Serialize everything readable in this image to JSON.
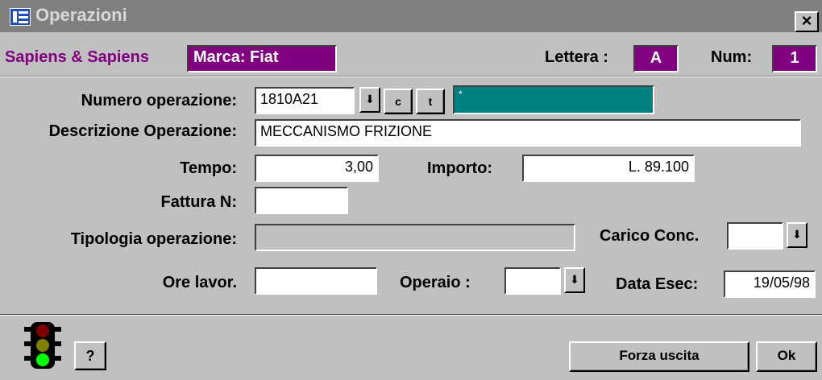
{
  "window": {
    "title": "Operazioni",
    "close_glyph": "×",
    "icon": "form-icon"
  },
  "header": {
    "company": "Sapiens & Sapiens",
    "marca": "Marca: Fiat",
    "lettera_label": "Lettera :",
    "lettera_value": "A",
    "num_label": "Num:",
    "num_value": "1"
  },
  "form": {
    "numero_operazione": {
      "label": "Numero operazione:",
      "value": "1810A21",
      "dropdown_glyph": "⬇",
      "btn_c": "c",
      "btn_t": "t",
      "code_value": "*"
    },
    "descrizione": {
      "label": "Descrizione Operazione:",
      "value": "MECCANISMO FRIZIONE"
    },
    "tempo": {
      "label": "Tempo:",
      "value": "3,00"
    },
    "importo": {
      "label": "Importo:",
      "value": "L. 89.100"
    },
    "fattura": {
      "label": "Fattura N:",
      "value": ""
    },
    "tipologia": {
      "label": "Tipologia operazione:",
      "value": ""
    },
    "carico_conc": {
      "label": "Carico Conc.",
      "value": ""
    },
    "ore_lavor": {
      "label": "Ore lavor.",
      "value": ""
    },
    "operaio": {
      "label": "Operaio :",
      "value": ""
    },
    "data_esec": {
      "label": "Data Esec:",
      "value": "19/05/98"
    }
  },
  "footer": {
    "help_label": "?",
    "forza_uscita_label": "Forza uscita",
    "ok_label": "Ok",
    "traffic_light_icon": "traffic-light-icon",
    "colors": {
      "red": "#800000",
      "yellow": "#808000",
      "green": "#00ff00"
    }
  }
}
